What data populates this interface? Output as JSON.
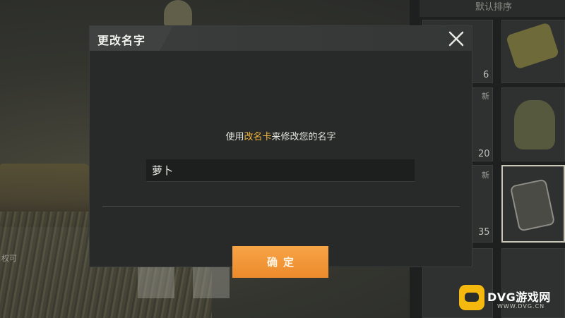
{
  "background": {
    "hint_text": "权可",
    "inventory": {
      "sort_label": "默认排序",
      "slots": [
        {
          "count": "6",
          "new_label": "",
          "icon": "rename-card-icon"
        },
        {
          "count": "20",
          "new_label": "新",
          "icon": "rice-dumpling-icon"
        },
        {
          "count": "35",
          "new_label": "新",
          "icon": "id-card-icon"
        }
      ]
    }
  },
  "modal": {
    "title": "更改名字",
    "instruction_prefix": "使用",
    "instruction_highlight": "改名卡",
    "instruction_suffix": "来修改您的名字",
    "name_input_value": "萝卜",
    "confirm_label": "确定",
    "close_icon": "close-icon"
  },
  "watermark": {
    "brand": "DVG游戏网",
    "url": "WWW.DVG.CN"
  },
  "colors": {
    "accent_orange": "#ec8b2b",
    "highlight_gold": "#f0b53c",
    "modal_bg": "#272a29"
  }
}
